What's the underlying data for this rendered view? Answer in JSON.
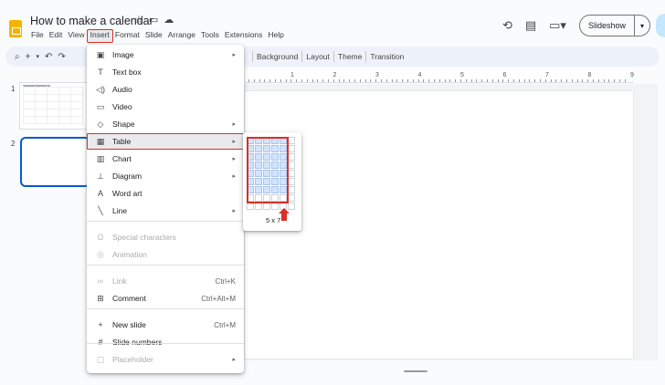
{
  "title_bar": {
    "doc_title": "How to make a calendar",
    "icons": [
      "star-icon",
      "move-to-folder-icon",
      "cloud-status-icon"
    ]
  },
  "menubar": {
    "items": [
      "File",
      "Edit",
      "View",
      "Insert",
      "Format",
      "Slide",
      "Arrange",
      "Tools",
      "Extensions",
      "Help"
    ],
    "active": "Insert"
  },
  "header_right": {
    "icons": [
      "history-icon",
      "comment-icon",
      "camera-icon"
    ],
    "slideshow_label": "Slideshow"
  },
  "toolbar": {
    "left_icons": [
      "search-icon",
      "add-icon",
      "undo-icon",
      "redo-icon"
    ],
    "buttons": [
      "Background",
      "Layout",
      "Theme",
      "Transition"
    ]
  },
  "ruler": {
    "labels": [
      "1",
      "2",
      "3",
      "4",
      "5",
      "6",
      "7",
      "8",
      "9"
    ]
  },
  "filmstrip": {
    "slide_numbers": [
      "1",
      "2"
    ]
  },
  "insert_menu": {
    "items": [
      {
        "label": "Image",
        "icon": "image-icon",
        "submenu": true,
        "disabled": false,
        "shortcut": ""
      },
      {
        "label": "Text box",
        "icon": "text-box-icon",
        "submenu": false,
        "disabled": false,
        "shortcut": ""
      },
      {
        "label": "Audio",
        "icon": "audio-icon",
        "submenu": false,
        "disabled": false,
        "shortcut": ""
      },
      {
        "label": "Video",
        "icon": "video-icon",
        "submenu": false,
        "disabled": false,
        "shortcut": ""
      },
      {
        "label": "Shape",
        "icon": "shape-icon",
        "submenu": true,
        "disabled": false,
        "shortcut": ""
      },
      {
        "label": "Table",
        "icon": "table-icon",
        "submenu": true,
        "disabled": false,
        "shortcut": ""
      },
      {
        "label": "Chart",
        "icon": "chart-icon",
        "submenu": true,
        "disabled": false,
        "shortcut": ""
      },
      {
        "label": "Diagram",
        "icon": "diagram-icon",
        "submenu": true,
        "disabled": false,
        "shortcut": ""
      },
      {
        "label": "Word art",
        "icon": "word-art-icon",
        "submenu": false,
        "disabled": false,
        "shortcut": ""
      },
      {
        "label": "Line",
        "icon": "line-icon",
        "submenu": true,
        "disabled": false,
        "shortcut": ""
      },
      {
        "label": "Special characters",
        "icon": "omega-icon",
        "submenu": false,
        "disabled": true,
        "shortcut": ""
      },
      {
        "label": "Animation",
        "icon": "animation-icon",
        "submenu": false,
        "disabled": true,
        "shortcut": ""
      },
      {
        "label": "Link",
        "icon": "link-icon",
        "submenu": false,
        "disabled": true,
        "shortcut": "Ctrl+K"
      },
      {
        "label": "Comment",
        "icon": "add-comment-icon",
        "submenu": false,
        "disabled": false,
        "shortcut": "Ctrl+Alt+M"
      },
      {
        "label": "New slide",
        "icon": "plus-icon",
        "submenu": false,
        "disabled": false,
        "shortcut": "Ctrl+M"
      },
      {
        "label": "Slide numbers",
        "icon": "hash-icon",
        "submenu": false,
        "disabled": false,
        "shortcut": ""
      },
      {
        "label": "Placeholder",
        "icon": "placeholder-icon",
        "submenu": true,
        "disabled": true,
        "shortcut": ""
      }
    ],
    "highlighted": "Table"
  },
  "table_picker": {
    "columns": 5,
    "rows": 7,
    "label": "5 x 7",
    "highlight_color": "#d93025"
  },
  "colors": {
    "accent_red": "#d93025",
    "selection_blue": "#0b57d0",
    "grid_fill": "#d2e3fc"
  }
}
